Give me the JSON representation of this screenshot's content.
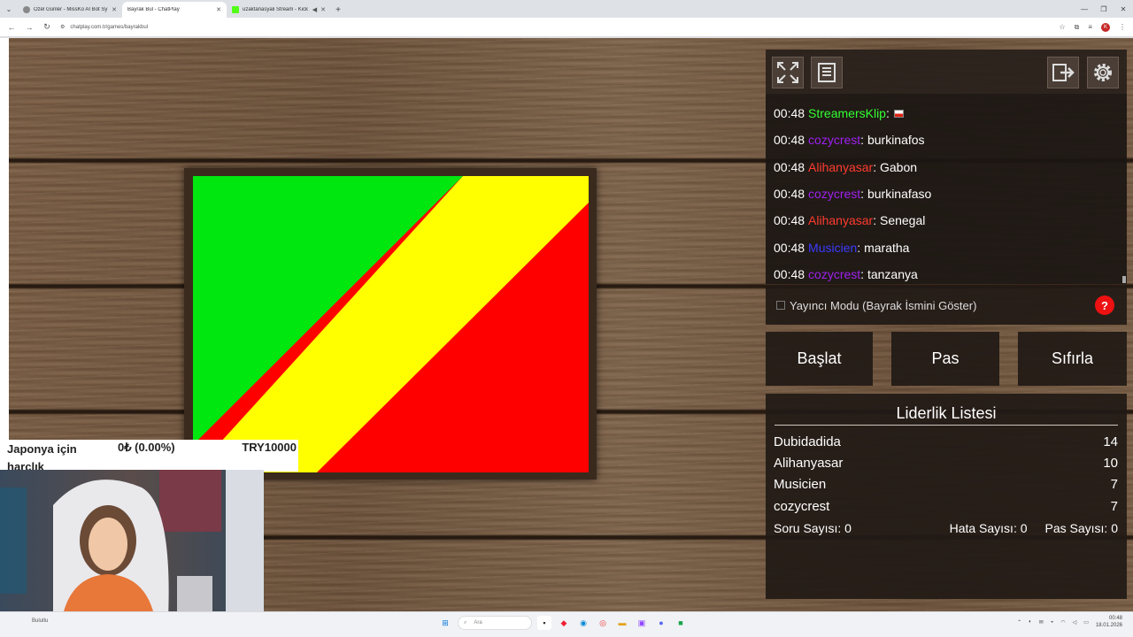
{
  "browser": {
    "tabs": [
      {
        "title": "Özel Günler - MissKo AI Bot Sy…",
        "active": false
      },
      {
        "title": "Bayrak Bul - ChatPlay",
        "active": true
      },
      {
        "title": "uzaktanasyali Stream - Kick",
        "active": false
      }
    ],
    "url": "chatplay.com.tr/games/bayrakbul",
    "profile_initial": "K"
  },
  "chat": {
    "messages": [
      {
        "time": "00:48",
        "user": "StreamersKlip",
        "color": "#33ff33",
        "text": "",
        "flag": true
      },
      {
        "time": "00:48",
        "user": "cozycrest",
        "color": "#a020f0",
        "text": "burkinafos"
      },
      {
        "time": "00:48",
        "user": "Alihanyasar",
        "color": "#ff3b2f",
        "text": "Gabon"
      },
      {
        "time": "00:48",
        "user": "cozycrest",
        "color": "#a020f0",
        "text": "burkinafaso"
      },
      {
        "time": "00:48",
        "user": "Alihanyasar",
        "color": "#ff3b2f",
        "text": "Senegal"
      },
      {
        "time": "00:48",
        "user": "Musicien",
        "color": "#3b3bff",
        "text": "maratha"
      },
      {
        "time": "00:48",
        "user": "cozycrest",
        "color": "#a020f0",
        "text": "tanzanya"
      }
    ]
  },
  "mode": {
    "label": "Yayıncı Modu (Bayrak İsmini Göster)",
    "help": "?"
  },
  "buttons": {
    "start": "Başlat",
    "pass": "Pas",
    "reset": "Sıfırla"
  },
  "leaderboard": {
    "title": "Liderlik Listesi",
    "entries": [
      {
        "name": "Dubidadida",
        "score": "14"
      },
      {
        "name": "Alihanyasar",
        "score": "10"
      },
      {
        "name": "Musicien",
        "score": "7"
      },
      {
        "name": "cozycrest",
        "score": "7"
      }
    ],
    "question_count": "Soru Sayısı: 0",
    "error_count": "Hata Sayısı: 0",
    "pass_count": "Pas Sayısı: 0"
  },
  "flag": {
    "colors": {
      "green": "#00e60f",
      "yellow": "#ffff00",
      "red": "#ff0000"
    }
  },
  "donation": {
    "label": "Japonya için harçlık",
    "amount": "0₺ (0.00%)",
    "goal": "TRY10000",
    "progress": 0
  },
  "taskbar": {
    "left_text": "Bulutlu",
    "search_placeholder": "Ara",
    "time": "00:48",
    "date": "18.01.2026"
  }
}
